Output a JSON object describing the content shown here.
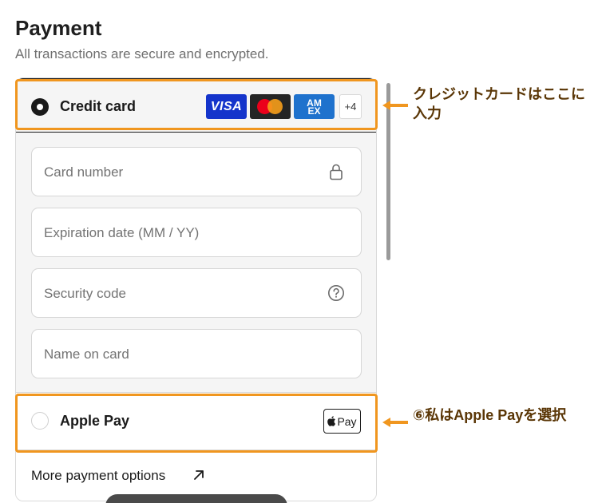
{
  "header": {
    "title": "Payment",
    "subtitle": "All transactions are secure and encrypted."
  },
  "credit_card": {
    "label": "Credit card",
    "selected": true,
    "brands": {
      "visa": "VISA",
      "amex_line1": "AM",
      "amex_line2": "EX",
      "more": "+4"
    },
    "fields": {
      "card_number": "Card number",
      "expiration": "Expiration date (MM / YY)",
      "security_code": "Security code",
      "name_on_card": "Name on card"
    }
  },
  "apple_pay": {
    "label": "Apple Pay",
    "selected": false,
    "badge": "Pay"
  },
  "more_options": {
    "label": "More payment options"
  },
  "annotations": {
    "credit_card_note": "クレジットカードはここに入力",
    "apple_pay_note": "⑥私はApple Payを選択"
  },
  "colors": {
    "highlight": "#f0961f",
    "annotation_text": "#5a3606",
    "visa": "#1434cb",
    "amex": "#1f72cd"
  }
}
